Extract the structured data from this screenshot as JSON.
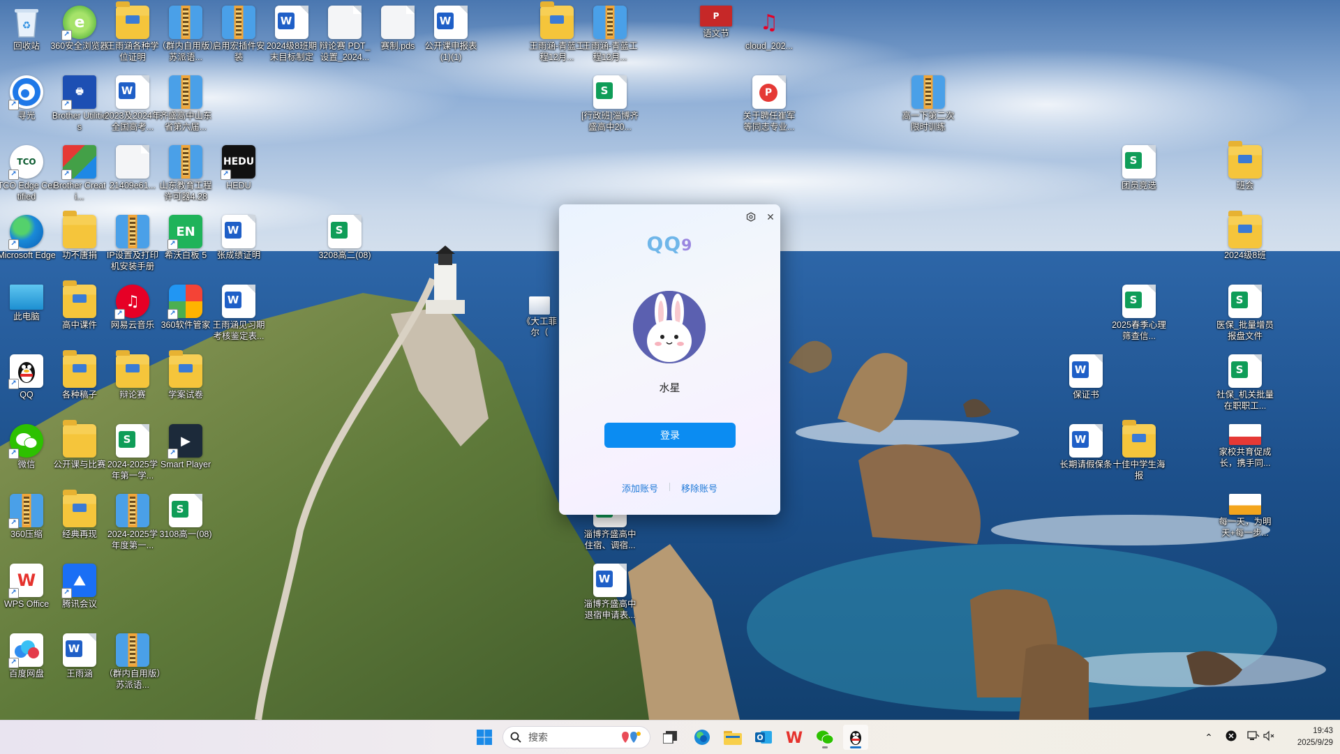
{
  "desktop_icons": [
    {
      "label": "回收站",
      "kind": "recycle"
    },
    {
      "label": "360安全浏览器",
      "kind": "app360browser"
    },
    {
      "label": "王雨涵各种学位证明",
      "kind": "folder"
    },
    {
      "label": "（群内自用版）苏派语...",
      "kind": "zip"
    },
    {
      "label": "启用宏插件安装",
      "kind": "zip"
    },
    {
      "label": "2024级8班期末目标制定",
      "kind": "word"
    },
    {
      "label": "辩论赛 PDT_设置_2024...",
      "kind": "plain"
    },
    {
      "label": "赛制.pds",
      "kind": "plain"
    },
    {
      "label": "公开课申报表(1)(1)",
      "kind": "word"
    },
    {
      "label": "王雨涵-青蓝工程12月...",
      "kind": "folder"
    },
    {
      "label": "王雨涵-青蓝工程12月...",
      "kind": "zip"
    },
    {
      "label": "语文节",
      "kind": "ppt"
    },
    {
      "label": "cloud_202...",
      "kind": "netease"
    },
    {
      "label": "寻光",
      "kind": "xunguang"
    },
    {
      "label": "Brother Utilities",
      "kind": "brother"
    },
    {
      "label": "2023及2024年全国高考...",
      "kind": "word"
    },
    {
      "label": "齐盛高中山东省第六届...",
      "kind": "zip"
    },
    {
      "label": "[行政班]淄博齐盛高中20...",
      "kind": "sheet"
    },
    {
      "label": "关于聘任崔军等同志专业...",
      "kind": "pdf"
    },
    {
      "label": "高一下第二次限时训练",
      "kind": "zip"
    },
    {
      "label": "TCO Edge Certified",
      "kind": "tco"
    },
    {
      "label": "Brother Creati...",
      "kind": "brothercreative"
    },
    {
      "label": "21409e61...",
      "kind": "plain"
    },
    {
      "label": "山东教育工程许可器4.28",
      "kind": "zip"
    },
    {
      "label": "HEDU",
      "kind": "hedu"
    },
    {
      "label": "团员竞选",
      "kind": "sheet"
    },
    {
      "label": "班会",
      "kind": "folder"
    },
    {
      "label": "Microsoft Edge",
      "kind": "edge"
    },
    {
      "label": "功不唐捐",
      "kind": "folder"
    },
    {
      "label": "IP设置及打印机安装手册",
      "kind": "zip"
    },
    {
      "label": "希沃白板 5",
      "kind": "seewo"
    },
    {
      "label": "张成绩证明",
      "kind": "word"
    },
    {
      "label": "3208高二(08)",
      "kind": "sheet"
    },
    {
      "label": "2024级8班",
      "kind": "folder"
    },
    {
      "label": "此电脑",
      "kind": "pc"
    },
    {
      "label": "高中课件",
      "kind": "folder"
    },
    {
      "label": "网易云音乐",
      "kind": "netease"
    },
    {
      "label": "360软件管家",
      "kind": "soft360"
    },
    {
      "label": "王雨涵见习期考核鉴定表...",
      "kind": "word"
    },
    {
      "label": "《大工菲尔（",
      "kind": "image"
    },
    {
      "label": "2025春季心理筛查信...",
      "kind": "sheet"
    },
    {
      "label": "医保_批量增员报盘文件",
      "kind": "sheet"
    },
    {
      "label": "QQ",
      "kind": "qq"
    },
    {
      "label": "各种稿子",
      "kind": "folder"
    },
    {
      "label": "辩论赛",
      "kind": "folder"
    },
    {
      "label": "学案试卷",
      "kind": "folder"
    },
    {
      "label": "保证书",
      "kind": "word"
    },
    {
      "label": "社保_机关批量在职职工...",
      "kind": "sheet"
    },
    {
      "label": "微信",
      "kind": "wechat"
    },
    {
      "label": "公开课与比赛",
      "kind": "folder"
    },
    {
      "label": "2024-2025学年第一学...",
      "kind": "sheet"
    },
    {
      "label": "Smart Player",
      "kind": "smartplayer"
    },
    {
      "label": "长期请假保条",
      "kind": "word"
    },
    {
      "label": "十佳中学生海报",
      "kind": "folder"
    },
    {
      "label": "家校共育促成长，携手同...",
      "kind": "pptimg"
    },
    {
      "label": "360压缩",
      "kind": "zip"
    },
    {
      "label": "经典再现",
      "kind": "folder"
    },
    {
      "label": "2024-2025学年度第一...",
      "kind": "zip"
    },
    {
      "label": "3108高一(08)",
      "kind": "sheet"
    },
    {
      "label": "淄博齐盛高中住宿、调宿...",
      "kind": "sheet"
    },
    {
      "label": "每一天，为明天+每一步...",
      "kind": "pptimg"
    },
    {
      "label": "WPS Office",
      "kind": "wps"
    },
    {
      "label": "腾讯会议",
      "kind": "meeting"
    },
    {
      "label": "淄博齐盛高中退宿申请表...",
      "kind": "word"
    },
    {
      "label": "百度网盘",
      "kind": "baidu"
    },
    {
      "label": "王雨涵",
      "kind": "word"
    },
    {
      "label": "（群内自用版）苏派语...",
      "kind": "zip"
    }
  ],
  "qq_dialog": {
    "logo_text": "QQ",
    "logo_version": "9",
    "username": "水星",
    "login_button": "登录",
    "add_account": "添加账号",
    "remove_account": "移除账号"
  },
  "taskbar": {
    "search_placeholder": "搜索",
    "pinned": [
      "start",
      "search",
      "task-view",
      "edge",
      "file-explorer",
      "outlook",
      "wps",
      "wechat",
      "qq"
    ],
    "clock_time": "19:43",
    "clock_date": "2025/9/29"
  }
}
